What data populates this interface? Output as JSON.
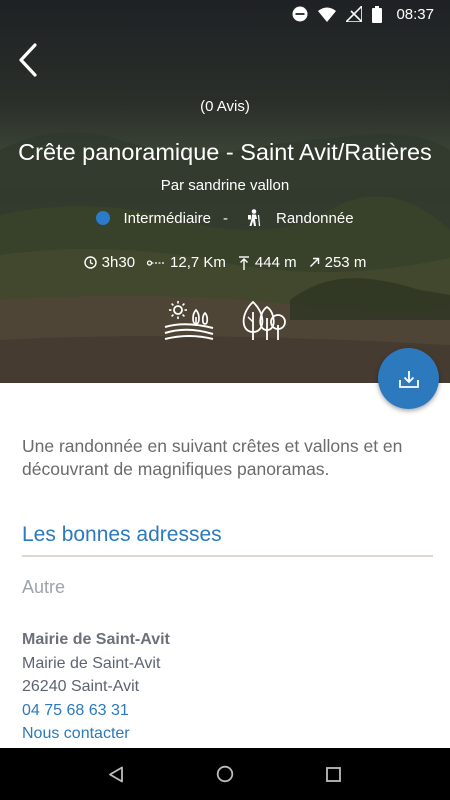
{
  "status_bar": {
    "time": "08:37"
  },
  "hero": {
    "reviews": "(0 Avis)",
    "title": "Crête panoramique - Saint Avit/Ratières",
    "author": "Par sandrine vallon",
    "level": "Intermédiaire",
    "separator": "-",
    "practice": "Randonnée",
    "stats": {
      "duration": "3h30",
      "distance": "12,7 Km",
      "max_altitude": "444 m",
      "elevation_gain": "253 m"
    },
    "type_icons": [
      "landscape-sun-icon",
      "forest-trees-icon"
    ],
    "level_color": "#2a7bc9"
  },
  "download_button": {
    "icon": "download-icon",
    "color": "#2c79bd"
  },
  "description": "Une randonnée en suivant crêtes et vallons et en découvrant de magnifiques panoramas.",
  "good_addresses": {
    "title": "Les bonnes adresses",
    "category": "Autre",
    "entry": {
      "name": "Mairie de Saint-Avit",
      "line1": "Mairie de Saint-Avit",
      "line2": "26240 Saint-Avit",
      "phone": "04 75 68 63 31",
      "contact": "Nous contacter"
    }
  },
  "nav_bar": {
    "buttons": [
      "back-icon",
      "home-icon",
      "recents-icon"
    ]
  }
}
